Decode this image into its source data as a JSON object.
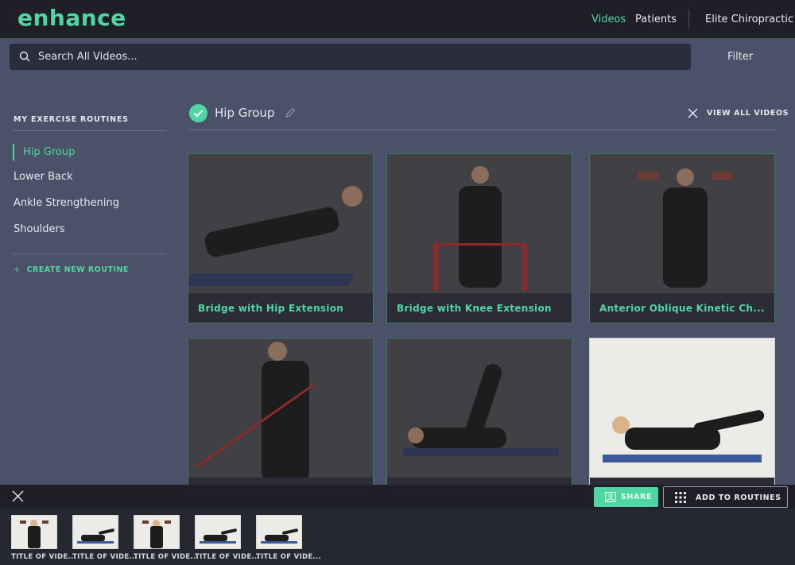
{
  "app": {
    "logo": "enhance"
  },
  "nav": {
    "videos": "Videos",
    "patients": "Patients",
    "practice": "Elite Chiropractic"
  },
  "search": {
    "placeholder": "Search All Videos...",
    "value": ""
  },
  "filter_label": "Filter",
  "sidebar": {
    "title": "MY EXERCISE ROUTINES",
    "items": [
      {
        "label": "Hip Group",
        "active": true
      },
      {
        "label": "Lower Back"
      },
      {
        "label": "Ankle Strengthening"
      },
      {
        "label": "Shoulders"
      }
    ],
    "create_label": "CREATE NEW ROUTINE"
  },
  "group": {
    "title": "Hip Group",
    "view_all": "VIEW ALL VIDEOS"
  },
  "videos": [
    {
      "title": "Bridge with Hip Extension"
    },
    {
      "title": "Bridge with Knee Extension"
    },
    {
      "title": "Anterior Oblique Kinetic Ch..."
    }
  ],
  "actions": {
    "share": "SHARE",
    "add_to_routines": "ADD TO ROUTINES"
  },
  "tray": [
    {
      "label": "TITLE OF VIDE..."
    },
    {
      "label": "TITLE OF VIDE..."
    },
    {
      "label": "TITLE OF VIDE..."
    },
    {
      "label": "TITLE OF VIDE..."
    },
    {
      "label": "TITLE OF VIDE..."
    }
  ],
  "colors": {
    "accent": "#4fd6a3",
    "background": "#4a5168",
    "topbar": "#1f1f27"
  }
}
